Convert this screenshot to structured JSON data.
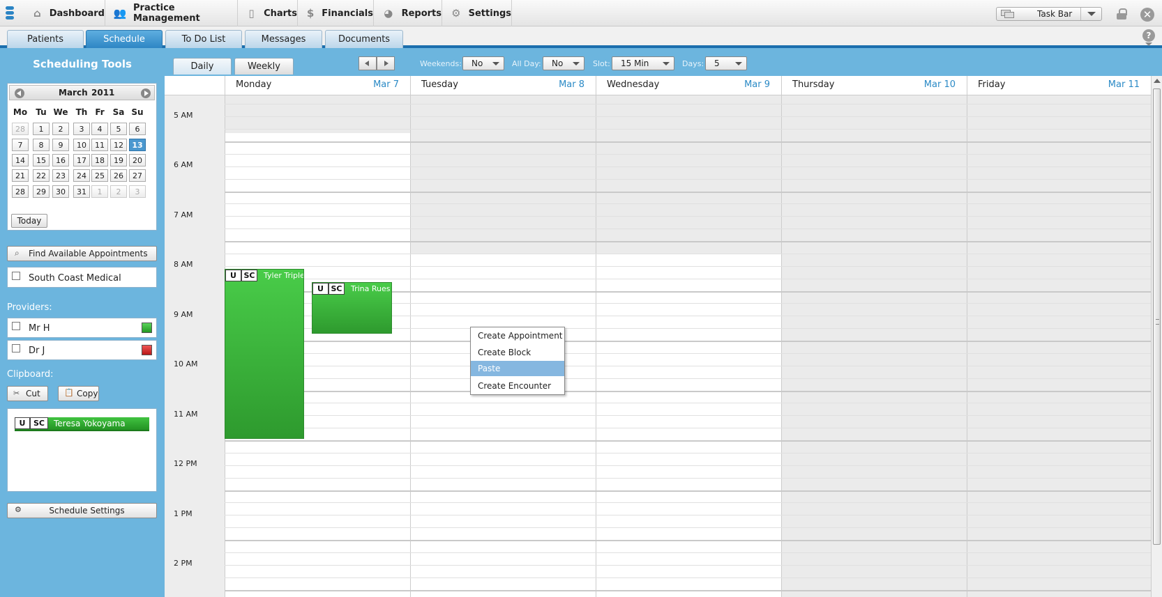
{
  "menu": {
    "items": [
      {
        "label": "Dashboard",
        "icon": "home-icon"
      },
      {
        "label": "Practice Management",
        "icon": "people-icon"
      },
      {
        "label": "Charts",
        "icon": "chart-doc-icon"
      },
      {
        "label": "Financials",
        "icon": "dollar-icon"
      },
      {
        "label": "Reports",
        "icon": "pie-chart-icon"
      },
      {
        "label": "Settings",
        "icon": "gear-icon"
      }
    ],
    "taskbar_label": "Task Bar"
  },
  "tabs": [
    {
      "label": "Patients",
      "active": false
    },
    {
      "label": "Schedule",
      "active": true
    },
    {
      "label": "To Do List",
      "active": false
    },
    {
      "label": "Messages",
      "active": false
    },
    {
      "label": "Documents",
      "active": false
    }
  ],
  "sidebar": {
    "title": "Scheduling Tools",
    "calendar": {
      "month": "March",
      "year": "2011",
      "weekdays": [
        "Mo",
        "Tu",
        "We",
        "Th",
        "Fr",
        "Sa",
        "Su"
      ],
      "weeks": [
        [
          "28",
          "1",
          "2",
          "3",
          "4",
          "5",
          "6"
        ],
        [
          "7",
          "8",
          "9",
          "10",
          "11",
          "12",
          "13"
        ],
        [
          "14",
          "15",
          "16",
          "17",
          "18",
          "19",
          "20"
        ],
        [
          "21",
          "22",
          "23",
          "24",
          "25",
          "26",
          "27"
        ],
        [
          "28",
          "29",
          "30",
          "31",
          "1",
          "2",
          "3"
        ]
      ],
      "selected_day": "13",
      "today_label": "Today"
    },
    "find_label": "Find Available Appointments",
    "facility": "South Coast Medical",
    "providers_label": "Providers:",
    "providers": [
      {
        "name": "Mr H",
        "color": "#2fb52f"
      },
      {
        "name": "Dr J",
        "color": "#d82a2a"
      }
    ],
    "clipboard_label": "Clipboard:",
    "cut_label": "Cut",
    "copy_label": "Copy",
    "clipboard_item": {
      "u": "U",
      "sc": "SC",
      "name": "Teresa Yokoyama"
    },
    "settings_label": "Schedule Settings"
  },
  "toolbar": {
    "daily_label": "Daily",
    "weekly_label": "Weekly",
    "weekends_label": "Weekends:",
    "weekends_value": "No",
    "allday_label": "All Day:",
    "allday_value": "No",
    "slot_label": "Slot:",
    "slot_value": "15 Min",
    "days_label": "Days:",
    "days_value": "5"
  },
  "calendar": {
    "days": [
      {
        "name": "Monday",
        "date": "Mar 7"
      },
      {
        "name": "Tuesday",
        "date": "Mar 8"
      },
      {
        "name": "Wednesday",
        "date": "Mar 9"
      },
      {
        "name": "Thursday",
        "date": "Mar 10"
      },
      {
        "name": "Friday",
        "date": "Mar 11"
      }
    ],
    "times": [
      "5 AM",
      "6 AM",
      "7 AM",
      "8 AM",
      "9 AM",
      "10 AM",
      "11 AM",
      "12 PM",
      "1 PM",
      "2 PM"
    ],
    "appointments": [
      {
        "u": "U",
        "sc": "SC",
        "name": "Tyler Triple"
      },
      {
        "u": "U",
        "sc": "SC",
        "name": "Trina Rues"
      }
    ]
  },
  "context_menu": {
    "items": [
      "Create Appointment",
      "Create Block",
      "Paste",
      "Create Encounter"
    ],
    "highlighted": "Paste"
  },
  "colors": {
    "accent": "#1b6fae",
    "panel_bg": "#6cb5de",
    "appointment_green": "#3cb43c",
    "highlight": "#85b7e0"
  }
}
